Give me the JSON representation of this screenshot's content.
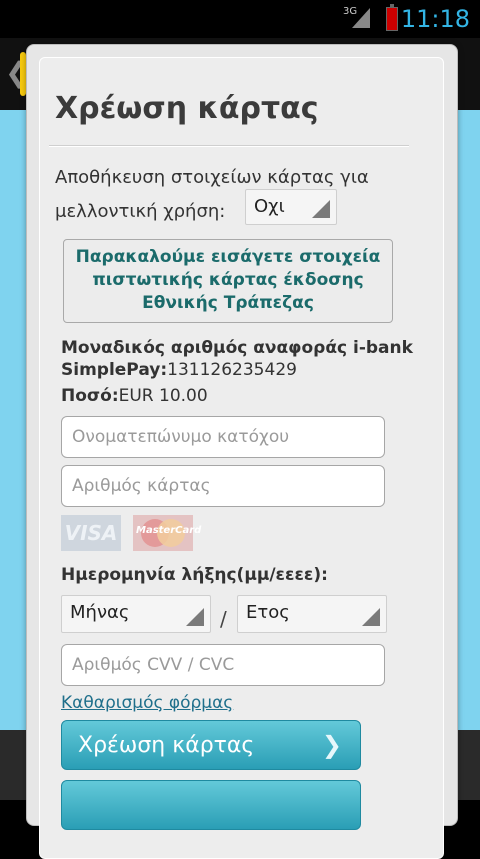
{
  "status_bar": {
    "time": "11:18",
    "network": "3G"
  },
  "dialog": {
    "title": "Χρέωση κάρτας",
    "save_text": "Αποθήκευση στοιχείων κάρτας για μελλοντική χρήση:",
    "save_select": "Οχι",
    "notice": "Παρακαλούμε εισάγετε στοιχεία πιστωτικής κάρτας έκδοσης Εθνικής Τράπεζας",
    "reference_label": "Μοναδικός αριθμός αναφοράς i-bank SimplePay:",
    "reference_value": "131126235429",
    "amount_label": "Ποσό:",
    "amount_value": "EUR 10.00",
    "cardholder_placeholder": "Ονοματεπώνυμο κατόχου",
    "card_number_placeholder": "Αριθμός κάρτας",
    "card_logos": {
      "visa": "VISA",
      "mastercard": "MasterCard"
    },
    "expiry_label": "Ημερομηνία λήξης(μμ/εεεε):",
    "month_select": "Μήνας",
    "expiry_separator": "/",
    "year_select": "Ετος",
    "cvv_placeholder": "Αριθμός CVV / CVC",
    "clear_link": "Καθαρισμός φόρμας",
    "charge_button": "Χρέωση κάρτας"
  },
  "colors": {
    "accent_blue": "#33b5e5",
    "notice_text": "#1b6b6b",
    "button": "#2a9eb5"
  }
}
